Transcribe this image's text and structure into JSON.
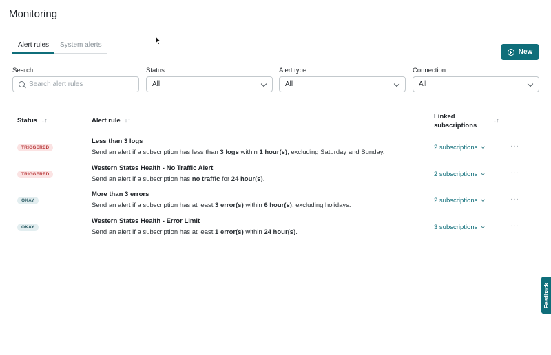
{
  "header": {
    "title": "Monitoring"
  },
  "tabs": [
    {
      "label": "Alert rules",
      "active": true
    },
    {
      "label": "System alerts",
      "active": false
    }
  ],
  "new_button": {
    "label": "New",
    "icon": "plus-circle-icon"
  },
  "filters": {
    "search": {
      "label": "Search",
      "placeholder": "Search alert rules"
    },
    "status": {
      "label": "Status",
      "value": "All"
    },
    "alert_type": {
      "label": "Alert type",
      "value": "All"
    },
    "connection": {
      "label": "Connection",
      "value": "All"
    }
  },
  "table": {
    "headers": {
      "status": "Status",
      "alert_rule": "Alert rule",
      "linked_line1": "Linked",
      "linked_line2": "subscriptions"
    },
    "rows": [
      {
        "status": "TRIGGERED",
        "name": "Less than 3 logs",
        "desc_parts": [
          "Send an alert if a subscription has less than ",
          "3 logs",
          " within ",
          "1 hour(s)",
          ", excluding Saturday and Sunday."
        ],
        "subscriptions": "2 subscriptions"
      },
      {
        "status": "TRIGGERED",
        "name": "Western States Health - No Traffic Alert",
        "desc_parts": [
          "Send an alert if a subscription has ",
          "no traffic",
          " for ",
          "24 hour(s)",
          "."
        ],
        "subscriptions": "2 subscriptions"
      },
      {
        "status": "OKAY",
        "name": "More than 3 errors",
        "desc_parts": [
          "Send an alert if a subscription has at least ",
          "3 error(s)",
          " within ",
          "6 hour(s)",
          ", excluding holidays."
        ],
        "subscriptions": "2 subscriptions"
      },
      {
        "status": "OKAY",
        "name": "Western States Health - Error Limit",
        "desc_parts": [
          "Send an alert if a subscription has at least ",
          "1 error(s)",
          " within ",
          "24 hour(s)",
          "."
        ],
        "subscriptions": "3 subscriptions"
      }
    ],
    "more_label": "···"
  },
  "feedback": {
    "label": "Feedback"
  },
  "colors": {
    "accent": "#0f6e7a",
    "triggered_bg": "#fbe3e3",
    "triggered_fg": "#b8393b",
    "okay_bg": "#e3eef0",
    "okay_fg": "#2d5d65"
  }
}
